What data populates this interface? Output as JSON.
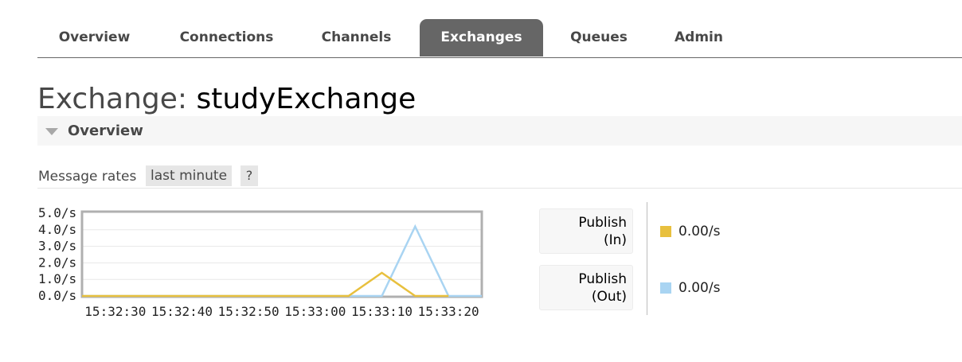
{
  "tabs": [
    {
      "label": "Overview",
      "active": false
    },
    {
      "label": "Connections",
      "active": false
    },
    {
      "label": "Channels",
      "active": false
    },
    {
      "label": "Exchanges",
      "active": true
    },
    {
      "label": "Queues",
      "active": false
    },
    {
      "label": "Admin",
      "active": false
    }
  ],
  "page": {
    "title_prefix": "Exchange:",
    "title_name": "studyExchange"
  },
  "section": {
    "title": "Overview",
    "icon": "triangle-down-icon"
  },
  "message_rates": {
    "label": "Message rates",
    "range": "last minute",
    "help": "?"
  },
  "legend": [
    {
      "label_line1": "Publish",
      "label_line2": "(In)",
      "rate": "0.00/s",
      "color": "#e8c03e"
    },
    {
      "label_line1": "Publish",
      "label_line2": "(Out)",
      "rate": "0.00/s",
      "color": "#a9d4f2"
    }
  ],
  "chart_data": {
    "type": "line",
    "y_ticks": [
      "5.0/s",
      "4.0/s",
      "3.0/s",
      "2.0/s",
      "1.0/s",
      "0.0/s"
    ],
    "ylim": [
      0,
      5
    ],
    "x_ticks": [
      "15:32:30",
      "15:32:40",
      "15:32:50",
      "15:33:00",
      "15:33:10",
      "15:33:20"
    ],
    "x": [
      "15:32:25",
      "15:32:30",
      "15:32:35",
      "15:32:40",
      "15:32:45",
      "15:32:50",
      "15:32:55",
      "15:33:00",
      "15:33:05",
      "15:33:10",
      "15:33:15",
      "15:33:20",
      "15:33:25"
    ],
    "series": [
      {
        "name": "Publish (In)",
        "color": "#e8c03e",
        "values": [
          0,
          0,
          0,
          0,
          0,
          0,
          0,
          0,
          0,
          1.4,
          0,
          0,
          null
        ]
      },
      {
        "name": "Publish (Out)",
        "color": "#a9d4f2",
        "values": [
          0,
          0,
          0,
          0,
          0,
          0,
          0,
          0,
          0,
          0,
          4.2,
          0,
          0
        ]
      }
    ],
    "grid": true
  }
}
